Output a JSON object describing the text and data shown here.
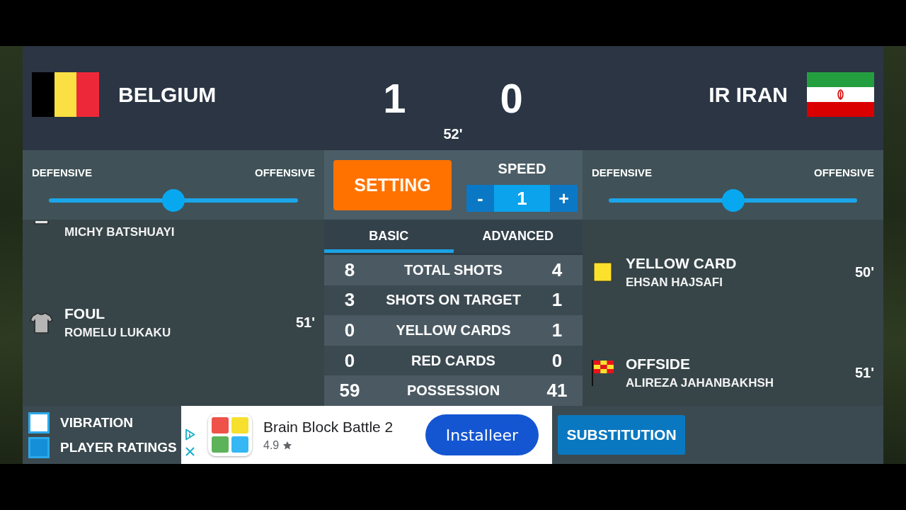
{
  "header": {
    "home": {
      "name": "BELGIUM"
    },
    "away": {
      "name": "IR IRAN"
    },
    "score": {
      "home": "1",
      "away": "0"
    },
    "minute": "52'"
  },
  "tactics": [
    {
      "min_label": "DEFENSIVE",
      "max_label": "OFFENSIVE",
      "level": 0.5
    },
    {
      "min_label": "DEFENSIVE",
      "max_label": "OFFENSIVE",
      "level": 0.5
    }
  ],
  "setting_button": "SETTING",
  "speed": {
    "label": "SPEED",
    "decrement": "-",
    "value": "1",
    "increment": "+"
  },
  "home_events": [
    {
      "kind": "cut",
      "player": "MICHY BATSHUAYI"
    },
    {
      "kind": "foul",
      "title": "FOUL",
      "player": "ROMELU LUKAKU",
      "minute": "51'"
    }
  ],
  "stats": {
    "tabs": [
      {
        "label": "BASIC",
        "selected": true
      },
      {
        "label": "ADVANCED",
        "selected": false
      }
    ],
    "rows": [
      {
        "home": "8",
        "label": "TOTAL SHOTS",
        "away": "4"
      },
      {
        "home": "3",
        "label": "SHOTS ON TARGET",
        "away": "1"
      },
      {
        "home": "0",
        "label": "YELLOW CARDS",
        "away": "1"
      },
      {
        "home": "0",
        "label": "RED CARDS",
        "away": "0"
      },
      {
        "home": "59",
        "label": "POSSESSION",
        "away": "41"
      }
    ]
  },
  "away_events": [
    {
      "kind": "yellow_card",
      "title": "YELLOW CARD",
      "player": "EHSAN HAJSAFI",
      "minute": "50'"
    },
    {
      "kind": "offside",
      "title": "OFFSIDE",
      "player": "ALIREZA JAHANBAKHSH",
      "minute": "51'"
    }
  ],
  "options": [
    {
      "label": "VIBRATION",
      "checked": false
    },
    {
      "label": "PLAYER RATINGS",
      "checked": true
    }
  ],
  "ad": {
    "title": "Brain Block Battle 2",
    "rating": "4.9",
    "button": "Installeer"
  },
  "substitution_button": "SUBSTITUTION"
}
